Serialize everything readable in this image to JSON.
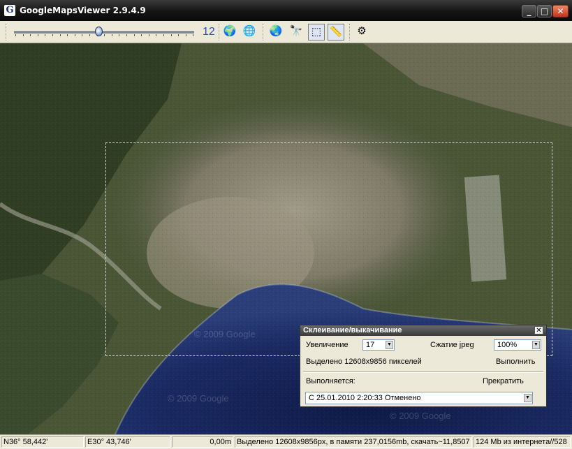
{
  "window": {
    "title": "GoogleMapsViewer 2.9.4.9",
    "icon_letter": "G"
  },
  "controls": {
    "minimize": "_",
    "maximize": "□",
    "close": "✕"
  },
  "toolbar": {
    "zoom_value": "12",
    "zoom_slider_fraction": 0.47,
    "buttons": [
      {
        "name": "globe-layers-icon",
        "glyph": "🌍"
      },
      {
        "name": "globe-icon",
        "glyph": "🌐"
      },
      {
        "name": "globe-refresh-icon",
        "glyph": "🌏"
      },
      {
        "name": "binoculars-icon",
        "glyph": "🔭"
      },
      {
        "name": "selection-rect-icon",
        "glyph": "⬚"
      },
      {
        "name": "ruler-icon",
        "glyph": "📏"
      },
      {
        "name": "gear-icon",
        "glyph": "⚙"
      }
    ]
  },
  "map": {
    "watermark": "© 2009 Google"
  },
  "dialog": {
    "title": "Склеивание/выкачивание",
    "close": "✕",
    "zoom_label": "Увеличение",
    "zoom_value": "17",
    "jpeg_label": "Сжатие jpeg",
    "jpeg_value": "100%",
    "selected_text": "Выделено 12608x9856 пикселей",
    "execute_button": "Выполнить",
    "running_label": "Выполняется:",
    "stop_button": "Прекратить",
    "task_value": "С 25.01.2010 2:20:33 Отменено"
  },
  "status": {
    "lat": "N36° 58,442'",
    "lon": "E30° 43,746'",
    "distance": "0,00m",
    "info": "Выделено 12608x9856px, в памяти 237,0156mb, скачать~11,8507",
    "net": "124 Mb из интернета//528"
  }
}
